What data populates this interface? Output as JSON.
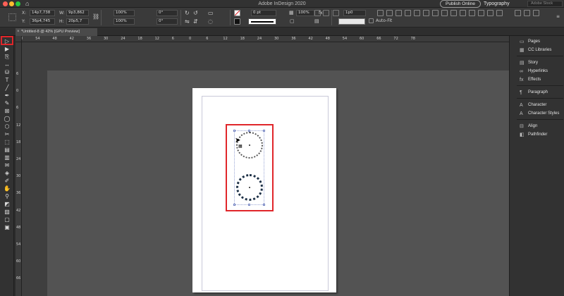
{
  "app": {
    "title": "Adobe InDesign 2020",
    "publish_label": "Publish Online",
    "workspace": "Typography",
    "search_placeholder": "Adobe Stock"
  },
  "colors": {
    "callout": "#e0262a",
    "traffic_close": "#ff5f57",
    "traffic_min": "#febc2e",
    "traffic_max": "#28c840"
  },
  "control": {
    "x_label": "X:",
    "x_value": "14p7,738",
    "y_label": "Y:",
    "y_value": "36p4,745",
    "w_label": "W:",
    "w_value": "9p3,862",
    "h_label": "H:",
    "h_value": "20p5,7",
    "scale_x": "100%",
    "scale_y": "100%",
    "rotate": "0°",
    "shear": "0°",
    "stroke_weight": "0 pt",
    "opacity": "100%",
    "gap": "1p0",
    "auto_fit": "Auto-Fit",
    "fx_label": "fx."
  },
  "document": {
    "tab_title": "*Untitled-8 @ 42% [GPU Preview]",
    "close_glyph": "×"
  },
  "ruler": {
    "h_ticks": [
      "60",
      "54",
      "48",
      "42",
      "36",
      "30",
      "24",
      "18",
      "12",
      "6",
      "0",
      "6",
      "12",
      "18",
      "24",
      "30",
      "36",
      "42",
      "48",
      "54",
      "60",
      "66",
      "72",
      "78"
    ],
    "v_ticks": [
      "6",
      "0",
      "6",
      "12",
      "18",
      "24",
      "30",
      "36",
      "42",
      "48",
      "54",
      "60",
      "66"
    ]
  },
  "tools": [
    {
      "name": "selection-tool",
      "glyph": "▷"
    },
    {
      "name": "direct-selection-tool",
      "glyph": "▶"
    },
    {
      "name": "page-tool",
      "glyph": "⎘"
    },
    {
      "name": "gap-tool",
      "glyph": "↔"
    },
    {
      "name": "content-collector-tool",
      "glyph": "⛁"
    },
    {
      "name": "type-tool",
      "glyph": "T"
    },
    {
      "name": "line-tool",
      "glyph": "╱"
    },
    {
      "name": "pen-tool",
      "glyph": "✒"
    },
    {
      "name": "pencil-tool",
      "glyph": "✎"
    },
    {
      "name": "rectangle-frame-tool",
      "glyph": "⊠"
    },
    {
      "name": "ellipse-tool",
      "glyph": "◯"
    },
    {
      "name": "polygon-tool",
      "glyph": "⬡"
    },
    {
      "name": "scissors-tool",
      "glyph": "✂"
    },
    {
      "name": "free-transform-tool",
      "glyph": "⬚"
    },
    {
      "name": "gradient-swatch-tool",
      "glyph": "▤"
    },
    {
      "name": "gradient-feather-tool",
      "glyph": "▥"
    },
    {
      "name": "note-tool",
      "glyph": "✉"
    },
    {
      "name": "color-theme-tool",
      "glyph": "◈"
    },
    {
      "name": "eyedropper-tool",
      "glyph": "✐"
    },
    {
      "name": "hand-tool",
      "glyph": "✋"
    },
    {
      "name": "zoom-tool",
      "glyph": "⚲"
    },
    {
      "name": "fill-stroke-swatch",
      "glyph": "◩"
    },
    {
      "name": "apply-none",
      "glyph": "▨"
    },
    {
      "name": "normal-mode",
      "glyph": "▢"
    },
    {
      "name": "screen-mode",
      "glyph": "▣"
    }
  ],
  "panels": [
    {
      "label": "Pages",
      "icon": "▭"
    },
    {
      "label": "CC Libraries",
      "icon": "▦"
    },
    {
      "label": "Story",
      "icon": "▤"
    },
    {
      "label": "Hyperlinks",
      "icon": "∞"
    },
    {
      "label": "Effects",
      "icon": "fx"
    },
    {
      "label": "Paragraph",
      "icon": "¶"
    },
    {
      "label": "Character",
      "icon": "A"
    },
    {
      "label": "Character Styles",
      "icon": "A"
    },
    {
      "label": "Align",
      "icon": "⊟"
    },
    {
      "label": "Pathfinder",
      "icon": "◧"
    }
  ]
}
